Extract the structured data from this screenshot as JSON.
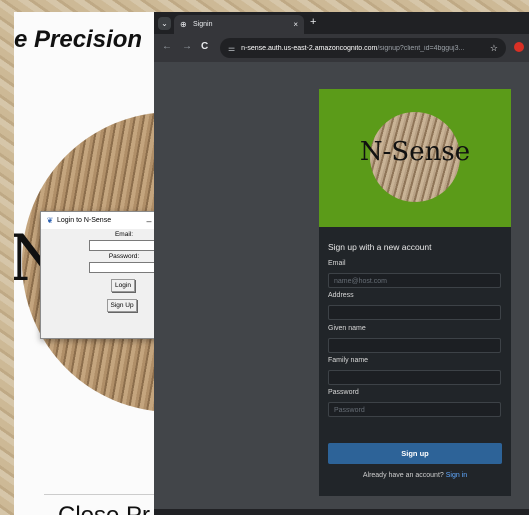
{
  "background_app": {
    "title": "e Precision",
    "circle_text": "N",
    "bottom_text": "Close Pr"
  },
  "tk_dialog": {
    "title": "Login to N-Sense",
    "minimize": "–",
    "maximize": "☐",
    "close": "✕",
    "email_label": "Email:",
    "email_value": "",
    "password_label": "Password:",
    "password_value": "",
    "login_button": "Login",
    "signup_button": "Sign Up"
  },
  "browser": {
    "tab_title": "Signin",
    "tab_close": "×",
    "new_tab": "+",
    "url_host": "n-sense.auth.us-east-2.amazoncognito.com",
    "url_path": "/signup?client_id=4bgguj3...",
    "back": "←",
    "forward": "→",
    "reload": "C",
    "star": "☆"
  },
  "signup_form": {
    "logo_text": "N-Sense",
    "heading": "Sign up with a new account",
    "fields": [
      {
        "label": "Email",
        "placeholder": "name@host.com"
      },
      {
        "label": "Address",
        "placeholder": ""
      },
      {
        "label": "Given name",
        "placeholder": ""
      },
      {
        "label": "Family name",
        "placeholder": ""
      },
      {
        "label": "Password",
        "placeholder": "Password"
      }
    ],
    "submit_label": "Sign up",
    "already_text": "Already have an account?",
    "signin_link": "Sign in"
  },
  "colors": {
    "banner_green": "#5b9b19",
    "card_dark": "#212529",
    "signup_blue": "#2d6398",
    "link_blue": "#5fa8ff"
  }
}
